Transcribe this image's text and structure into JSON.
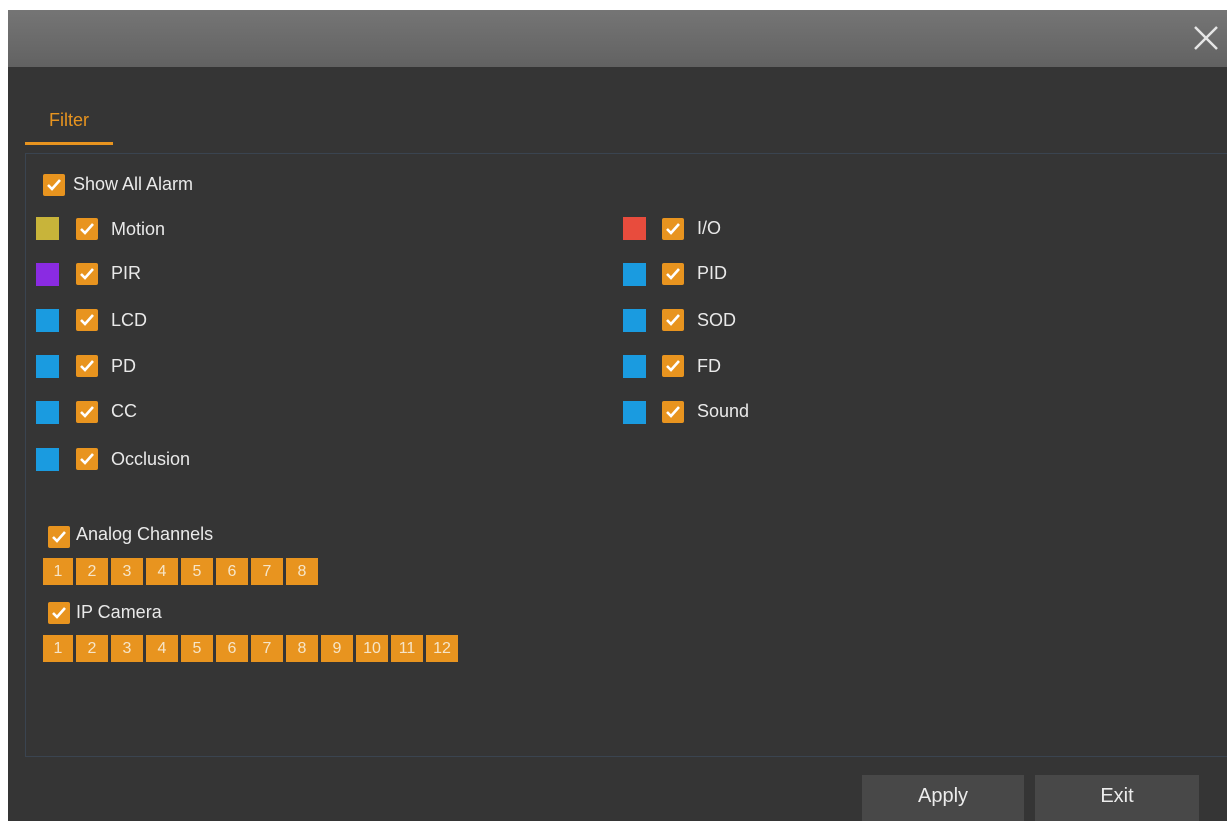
{
  "dialog": {
    "close_icon": "close-icon",
    "tab_label": "Filter"
  },
  "filter": {
    "show_all_label": "Show All Alarm",
    "show_all_checked": true,
    "alarm_types": [
      {
        "label": "Motion",
        "color": "#c8b43a",
        "checked": true
      },
      {
        "label": "PIR",
        "color": "#8a2be2",
        "checked": true
      },
      {
        "label": "LCD",
        "color": "#1a9be0",
        "checked": true
      },
      {
        "label": "PD",
        "color": "#1a9be0",
        "checked": true
      },
      {
        "label": "CC",
        "color": "#1a9be0",
        "checked": true
      },
      {
        "label": "Occlusion",
        "color": "#1a9be0",
        "checked": true
      },
      {
        "label": "I/O",
        "color": "#e84c3d",
        "checked": true
      },
      {
        "label": "PID",
        "color": "#1a9be0",
        "checked": true
      },
      {
        "label": "SOD",
        "color": "#1a9be0",
        "checked": true
      },
      {
        "label": "FD",
        "color": "#1a9be0",
        "checked": true
      },
      {
        "label": "Sound",
        "color": "#1a9be0",
        "checked": true
      }
    ],
    "analog_label": "Analog Channels",
    "analog_checked": true,
    "analog_channels": [
      "1",
      "2",
      "3",
      "4",
      "5",
      "6",
      "7",
      "8"
    ],
    "ip_label": "IP Camera",
    "ip_checked": true,
    "ip_channels": [
      "1",
      "2",
      "3",
      "4",
      "5",
      "6",
      "7",
      "8",
      "9",
      "10",
      "11",
      "12"
    ]
  },
  "buttons": {
    "apply_label": "Apply",
    "exit_label": "Exit"
  },
  "colors": {
    "accent": "#e8941f",
    "background": "#353535",
    "titlebar": "#6b6b6b"
  }
}
